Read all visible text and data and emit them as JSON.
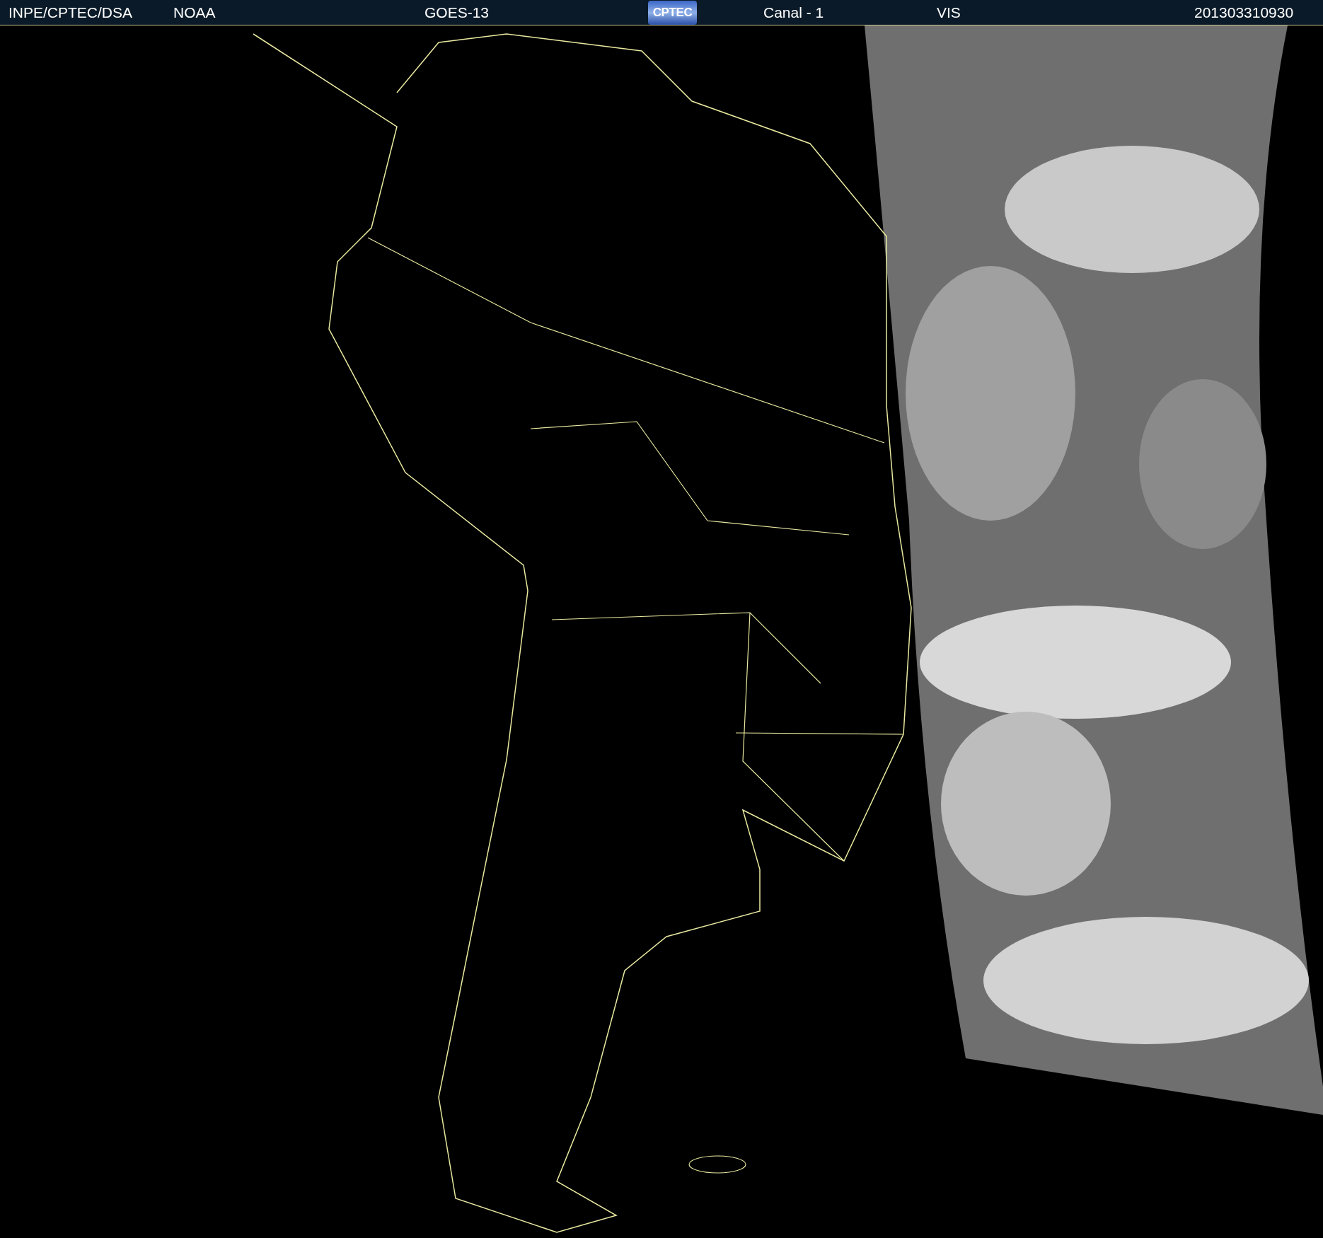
{
  "header": {
    "items": [
      {
        "kind": "text",
        "text": "INPE/CPTEC/DSA"
      },
      {
        "kind": "text",
        "text": "NOAA"
      },
      {
        "kind": "text",
        "text": "GOES-13"
      },
      {
        "kind": "logo",
        "text": "CPTEC"
      },
      {
        "kind": "text",
        "text": "Canal - 1"
      },
      {
        "kind": "text",
        "text": "VIS"
      },
      {
        "kind": "text",
        "text": "201303310930"
      }
    ]
  }
}
